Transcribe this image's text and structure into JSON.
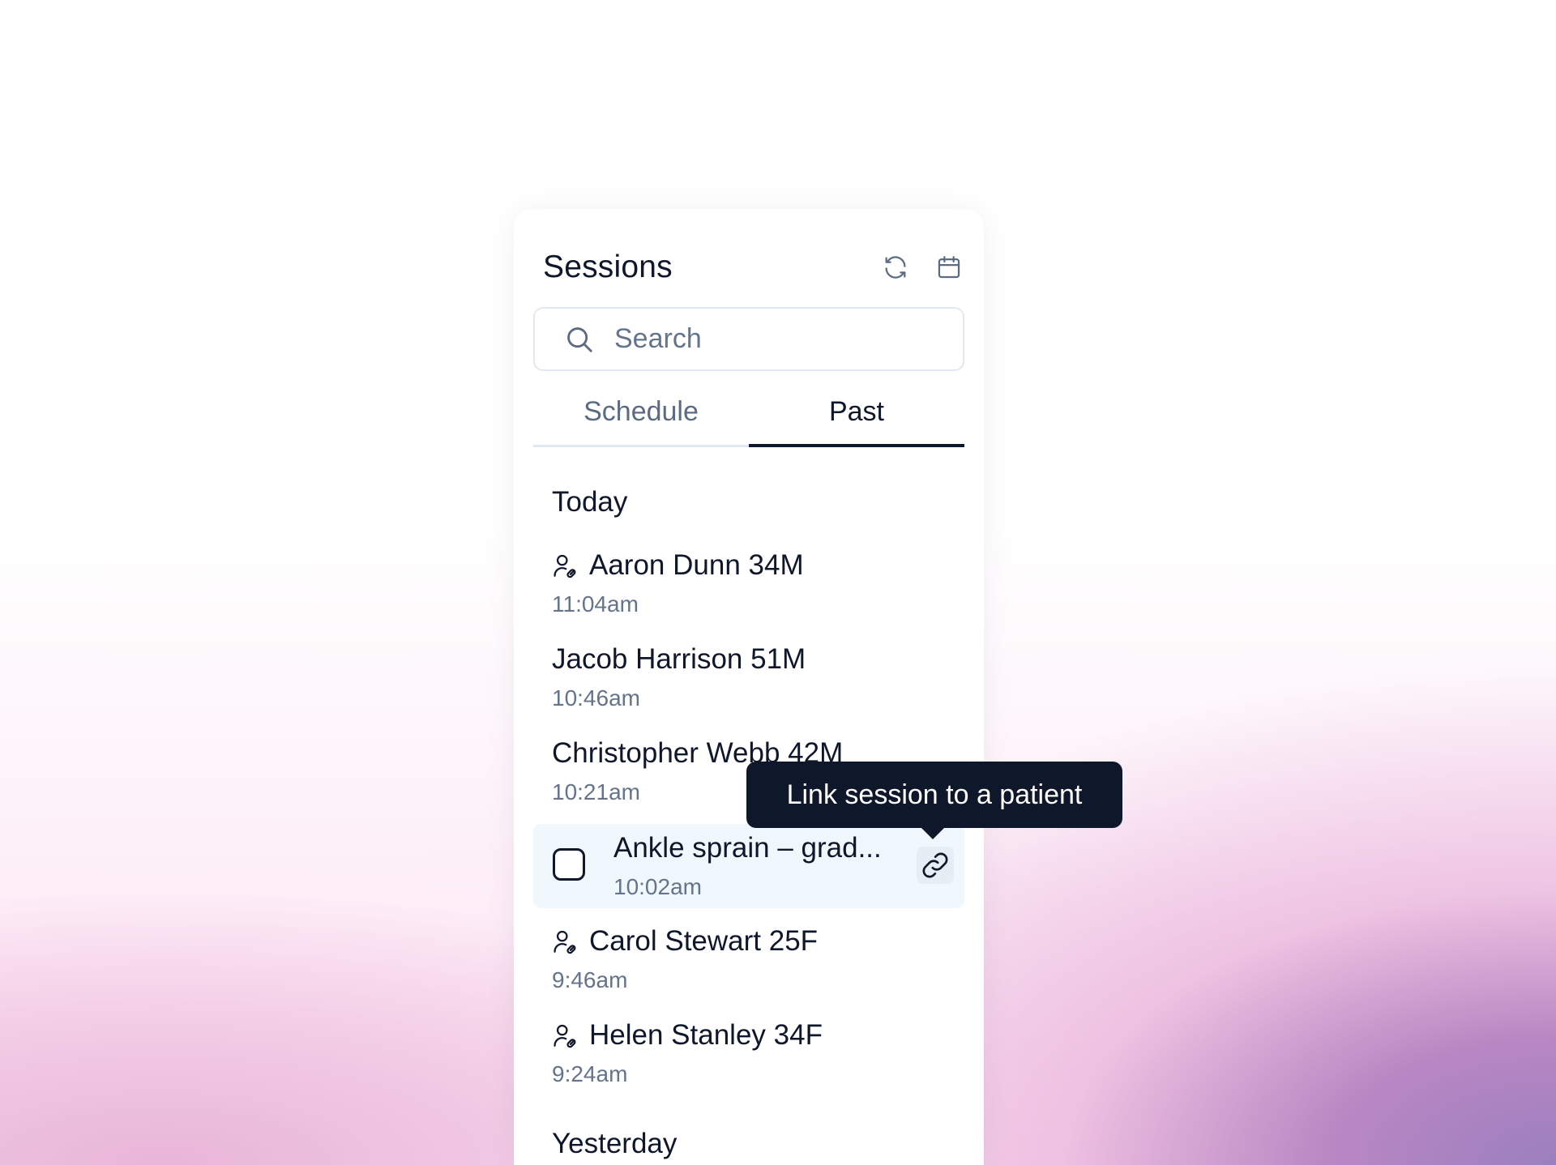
{
  "header": {
    "title": "Sessions",
    "refresh_icon": "refresh-icon",
    "calendar_icon": "calendar-icon"
  },
  "search": {
    "placeholder": "Search",
    "value": "",
    "icon": "search-icon"
  },
  "tabs": [
    {
      "label": "Schedule",
      "active": false
    },
    {
      "label": "Past",
      "active": true
    }
  ],
  "groups": [
    {
      "heading": "Today",
      "sessions": [
        {
          "name": "Aaron Dunn 34M",
          "time": "11:04am",
          "linked": true
        },
        {
          "name": "Jacob Harrison 51M",
          "time": "10:46am",
          "linked": false
        },
        {
          "name": "Christopher Webb 42M",
          "time": "10:21am",
          "linked": false
        },
        {
          "name": "Ankle sprain – grad...",
          "time": "10:02am",
          "linked": false,
          "selected": true
        },
        {
          "name": "Carol Stewart 25F",
          "time": "9:46am",
          "linked": true
        },
        {
          "name": "Helen Stanley 34F",
          "time": "9:24am",
          "linked": true
        }
      ]
    },
    {
      "heading": "Yesterday",
      "sessions": []
    }
  ],
  "tooltip": {
    "text": "Link session to a patient"
  },
  "colors": {
    "text_primary": "#0f172a",
    "text_secondary": "#64748b",
    "selected_row_bg": "#f0f7fd",
    "tooltip_bg": "#0f172a"
  }
}
